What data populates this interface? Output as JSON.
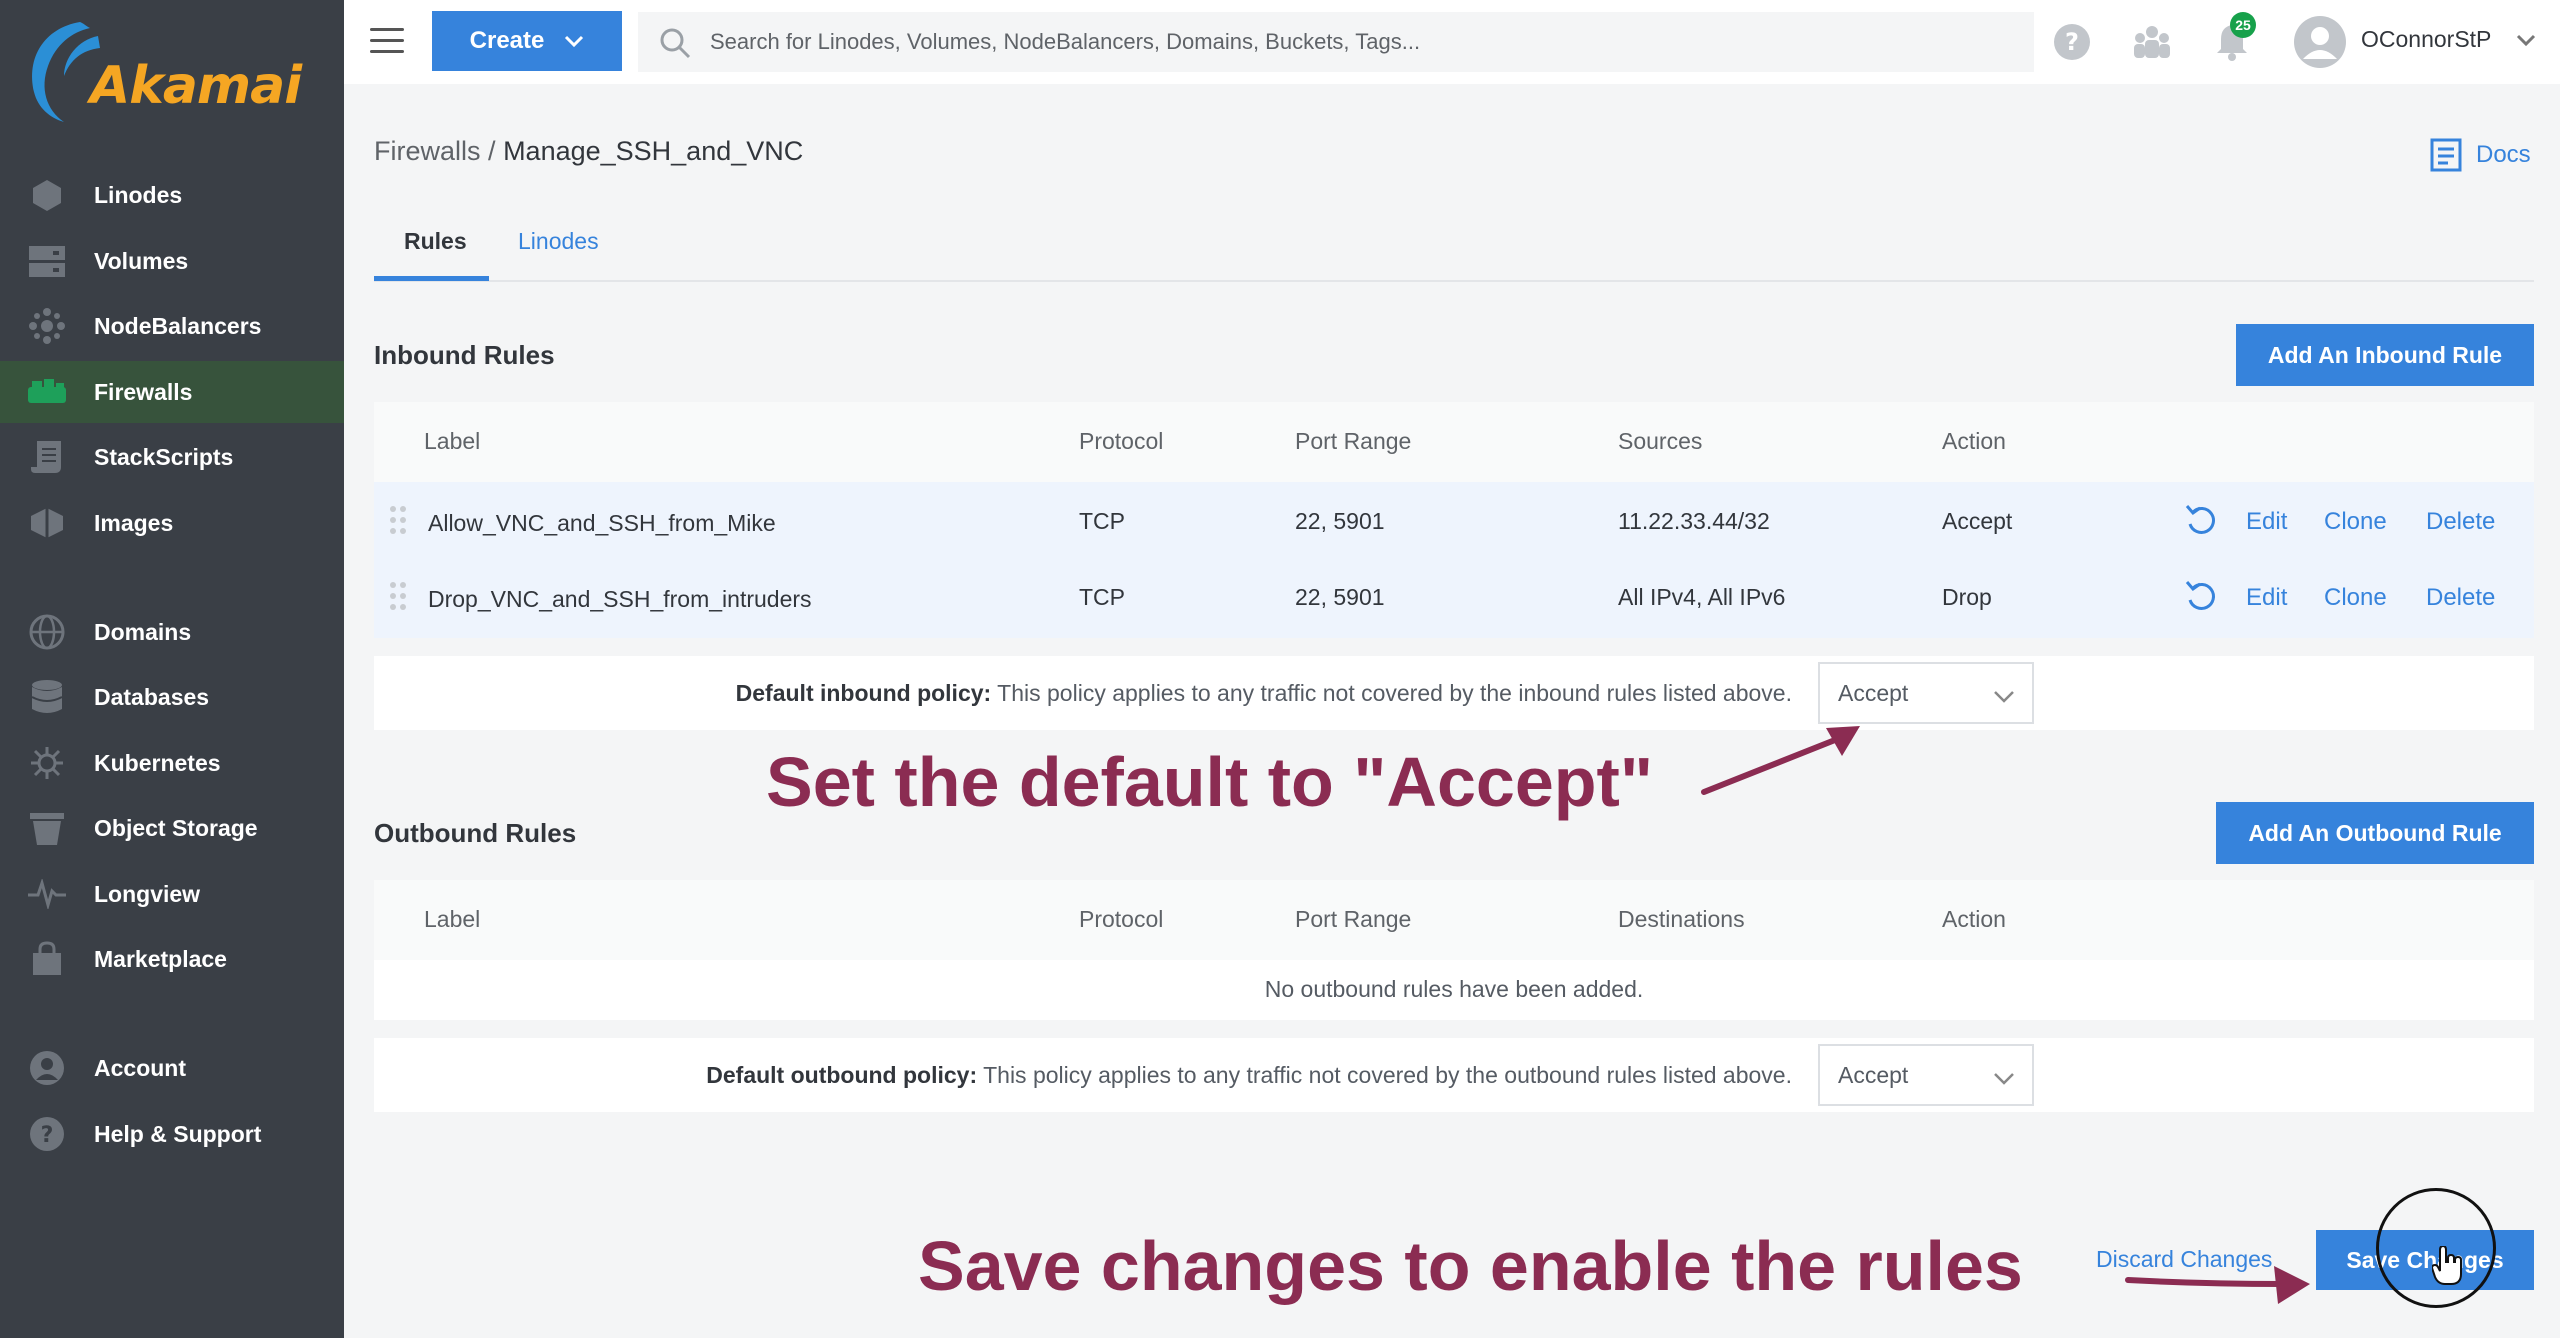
{
  "brand": {
    "logo_text": "Akamai"
  },
  "sidebar": {
    "items": [
      {
        "label": "Linodes",
        "icon": "hexagon-icon"
      },
      {
        "label": "Volumes",
        "icon": "volumes-icon"
      },
      {
        "label": "NodeBalancers",
        "icon": "nodebalancer-icon"
      },
      {
        "label": "Firewalls",
        "icon": "firewall-icon",
        "active": true
      },
      {
        "label": "StackScripts",
        "icon": "stackscript-icon"
      },
      {
        "label": "Images",
        "icon": "image-icon"
      },
      {
        "label": "Domains",
        "icon": "globe-icon"
      },
      {
        "label": "Databases",
        "icon": "database-icon"
      },
      {
        "label": "Kubernetes",
        "icon": "kubernetes-icon"
      },
      {
        "label": "Object Storage",
        "icon": "bucket-icon"
      },
      {
        "label": "Longview",
        "icon": "pulse-icon"
      },
      {
        "label": "Marketplace",
        "icon": "bag-icon"
      },
      {
        "label": "Account",
        "icon": "user-icon"
      },
      {
        "label": "Help & Support",
        "icon": "help-icon"
      }
    ]
  },
  "topbar": {
    "create_label": "Create",
    "search_placeholder": "Search for Linodes, Volumes, NodeBalancers, Domains, Buckets, Tags...",
    "notification_count": "25",
    "username": "OConnorStP"
  },
  "breadcrumb": {
    "parent": "Firewalls",
    "separator": "/",
    "current": "Manage_SSH_and_VNC"
  },
  "docs_label": "Docs",
  "tabs": [
    {
      "label": "Rules",
      "active": true
    },
    {
      "label": "Linodes",
      "active": false
    }
  ],
  "inbound": {
    "title": "Inbound Rules",
    "add_button": "Add An Inbound Rule",
    "columns": [
      "Label",
      "Protocol",
      "Port Range",
      "Sources",
      "Action"
    ],
    "rows": [
      {
        "label": "Allow_VNC_and_SSH_from_Mike",
        "protocol": "TCP",
        "ports": "22, 5901",
        "sources": "11.22.33.44/32",
        "action": "Accept"
      },
      {
        "label": "Drop_VNC_and_SSH_from_intruders",
        "protocol": "TCP",
        "ports": "22, 5901",
        "sources": "All IPv4, All IPv6",
        "action": "Drop"
      }
    ],
    "row_actions": {
      "edit": "Edit",
      "clone": "Clone",
      "delete": "Delete"
    },
    "policy_label": "Default inbound policy:",
    "policy_text": " This policy applies to any traffic not covered by the inbound rules listed above.",
    "policy_value": "Accept"
  },
  "outbound": {
    "title": "Outbound Rules",
    "add_button": "Add An Outbound Rule",
    "columns": [
      "Label",
      "Protocol",
      "Port Range",
      "Destinations",
      "Action"
    ],
    "empty_text": "No outbound rules have been added.",
    "policy_label": "Default outbound policy:",
    "policy_text": " This policy applies to any traffic not covered by the outbound rules listed above.",
    "policy_value": "Accept"
  },
  "annotations": {
    "default_note": "Set the default to \"Accept\"",
    "save_note": "Save changes to enable the rules",
    "color": "#8b2c52"
  },
  "footer": {
    "discard_label": "Discard Changes",
    "save_label": "Save Changes"
  },
  "colors": {
    "accent": "#3683dc",
    "sidebar": "#3a3f46",
    "active_nav": "#37533c",
    "brand": "#f5a623"
  }
}
